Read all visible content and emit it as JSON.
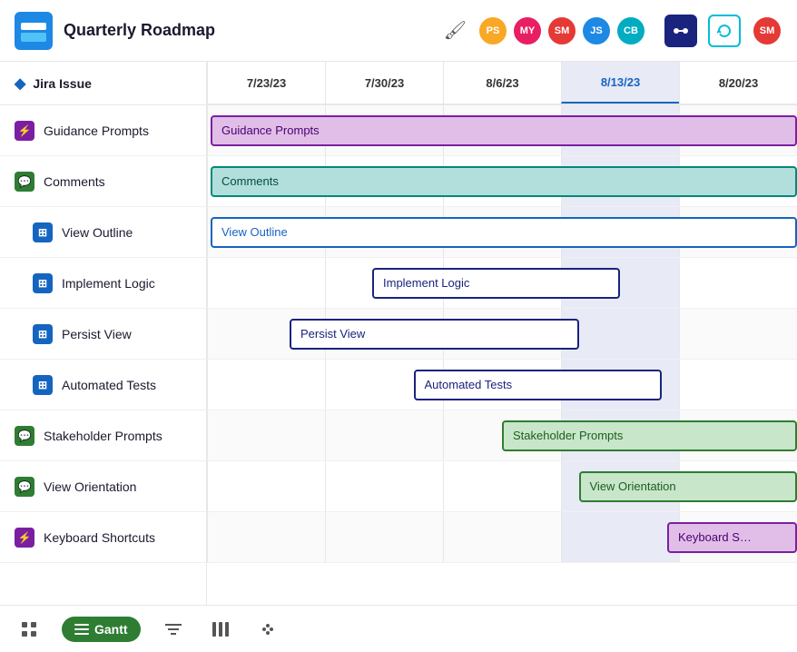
{
  "header": {
    "title": "Quarterly Roadmap",
    "avatars": [
      {
        "id": "ps",
        "initials": "PS",
        "color": "#f9a825"
      },
      {
        "id": "my",
        "initials": "MY",
        "color": "#e91e63"
      },
      {
        "id": "sm",
        "initials": "SM",
        "color": "#e53935"
      },
      {
        "id": "js",
        "initials": "JS",
        "color": "#1e88e5"
      },
      {
        "id": "cb",
        "initials": "CB",
        "color": "#00acc1"
      }
    ],
    "user_avatar": "SM",
    "user_color": "#e53935"
  },
  "sidebar": {
    "header_label": "Jira Issue",
    "items": [
      {
        "id": "guidance-prompts",
        "label": "Guidance Prompts",
        "icon_type": "purple",
        "indented": false
      },
      {
        "id": "comments",
        "label": "Comments",
        "icon_type": "green",
        "indented": false
      },
      {
        "id": "view-outline",
        "label": "View Outline",
        "icon_type": "blue",
        "indented": true
      },
      {
        "id": "implement-logic",
        "label": "Implement Logic",
        "icon_type": "blue",
        "indented": true
      },
      {
        "id": "persist-view",
        "label": "Persist View",
        "icon_type": "blue",
        "indented": true
      },
      {
        "id": "automated-tests",
        "label": "Automated Tests",
        "icon_type": "blue",
        "indented": true
      },
      {
        "id": "stakeholder-prompts",
        "label": "Stakeholder Prompts",
        "icon_type": "green",
        "indented": false
      },
      {
        "id": "view-orientation",
        "label": "View Orientation",
        "icon_type": "green",
        "indented": false
      },
      {
        "id": "keyboard-shortcuts",
        "label": "Keyboard Shortcuts",
        "icon_type": "purple",
        "indented": false
      }
    ]
  },
  "gantt": {
    "columns": [
      {
        "id": "7-23",
        "label": "7/23/23",
        "active": false
      },
      {
        "id": "7-30",
        "label": "7/30/23",
        "active": false
      },
      {
        "id": "8-6",
        "label": "8/6/23",
        "active": false
      },
      {
        "id": "8-13",
        "label": "8/13/23",
        "active": true
      },
      {
        "id": "8-20",
        "label": "8/20/23",
        "active": false
      }
    ],
    "rows": [
      {
        "id": "guidance-prompts",
        "bar_label": "Guidance Prompts",
        "bar_style": "purple",
        "left_pct": 0,
        "width_pct": 100
      },
      {
        "id": "comments",
        "bar_label": "Comments",
        "bar_style": "teal",
        "left_pct": 0,
        "width_pct": 100
      },
      {
        "id": "view-outline",
        "bar_label": "View Outline",
        "bar_style": "blue-outline",
        "left_pct": 0,
        "width_pct": 100
      },
      {
        "id": "implement-logic",
        "bar_label": "Implement Logic",
        "bar_style": "navy-outline",
        "left_pct": 22,
        "width_pct": 42
      },
      {
        "id": "persist-view",
        "bar_label": "Persist View",
        "bar_style": "navy-outline",
        "left_pct": 10,
        "width_pct": 49
      },
      {
        "id": "automated-tests",
        "bar_label": "Automated Tests",
        "bar_style": "navy-outline",
        "left_pct": 29,
        "width_pct": 41
      },
      {
        "id": "stakeholder-prompts",
        "bar_label": "Stakeholder Prompts",
        "bar_style": "green",
        "left_pct": 49,
        "width_pct": 51
      },
      {
        "id": "view-orientation",
        "bar_label": "View Orientation",
        "bar_style": "green",
        "left_pct": 62,
        "width_pct": 38
      },
      {
        "id": "keyboard-shortcuts",
        "bar_label": "Keyboard S…",
        "bar_style": "purple",
        "left_pct": 78,
        "width_pct": 22
      }
    ]
  },
  "bottom": {
    "gantt_tab_label": "Gantt"
  },
  "icons": {
    "pipe": "⊞",
    "gantt": "≡",
    "group": "⊡",
    "dots": "⁘"
  }
}
